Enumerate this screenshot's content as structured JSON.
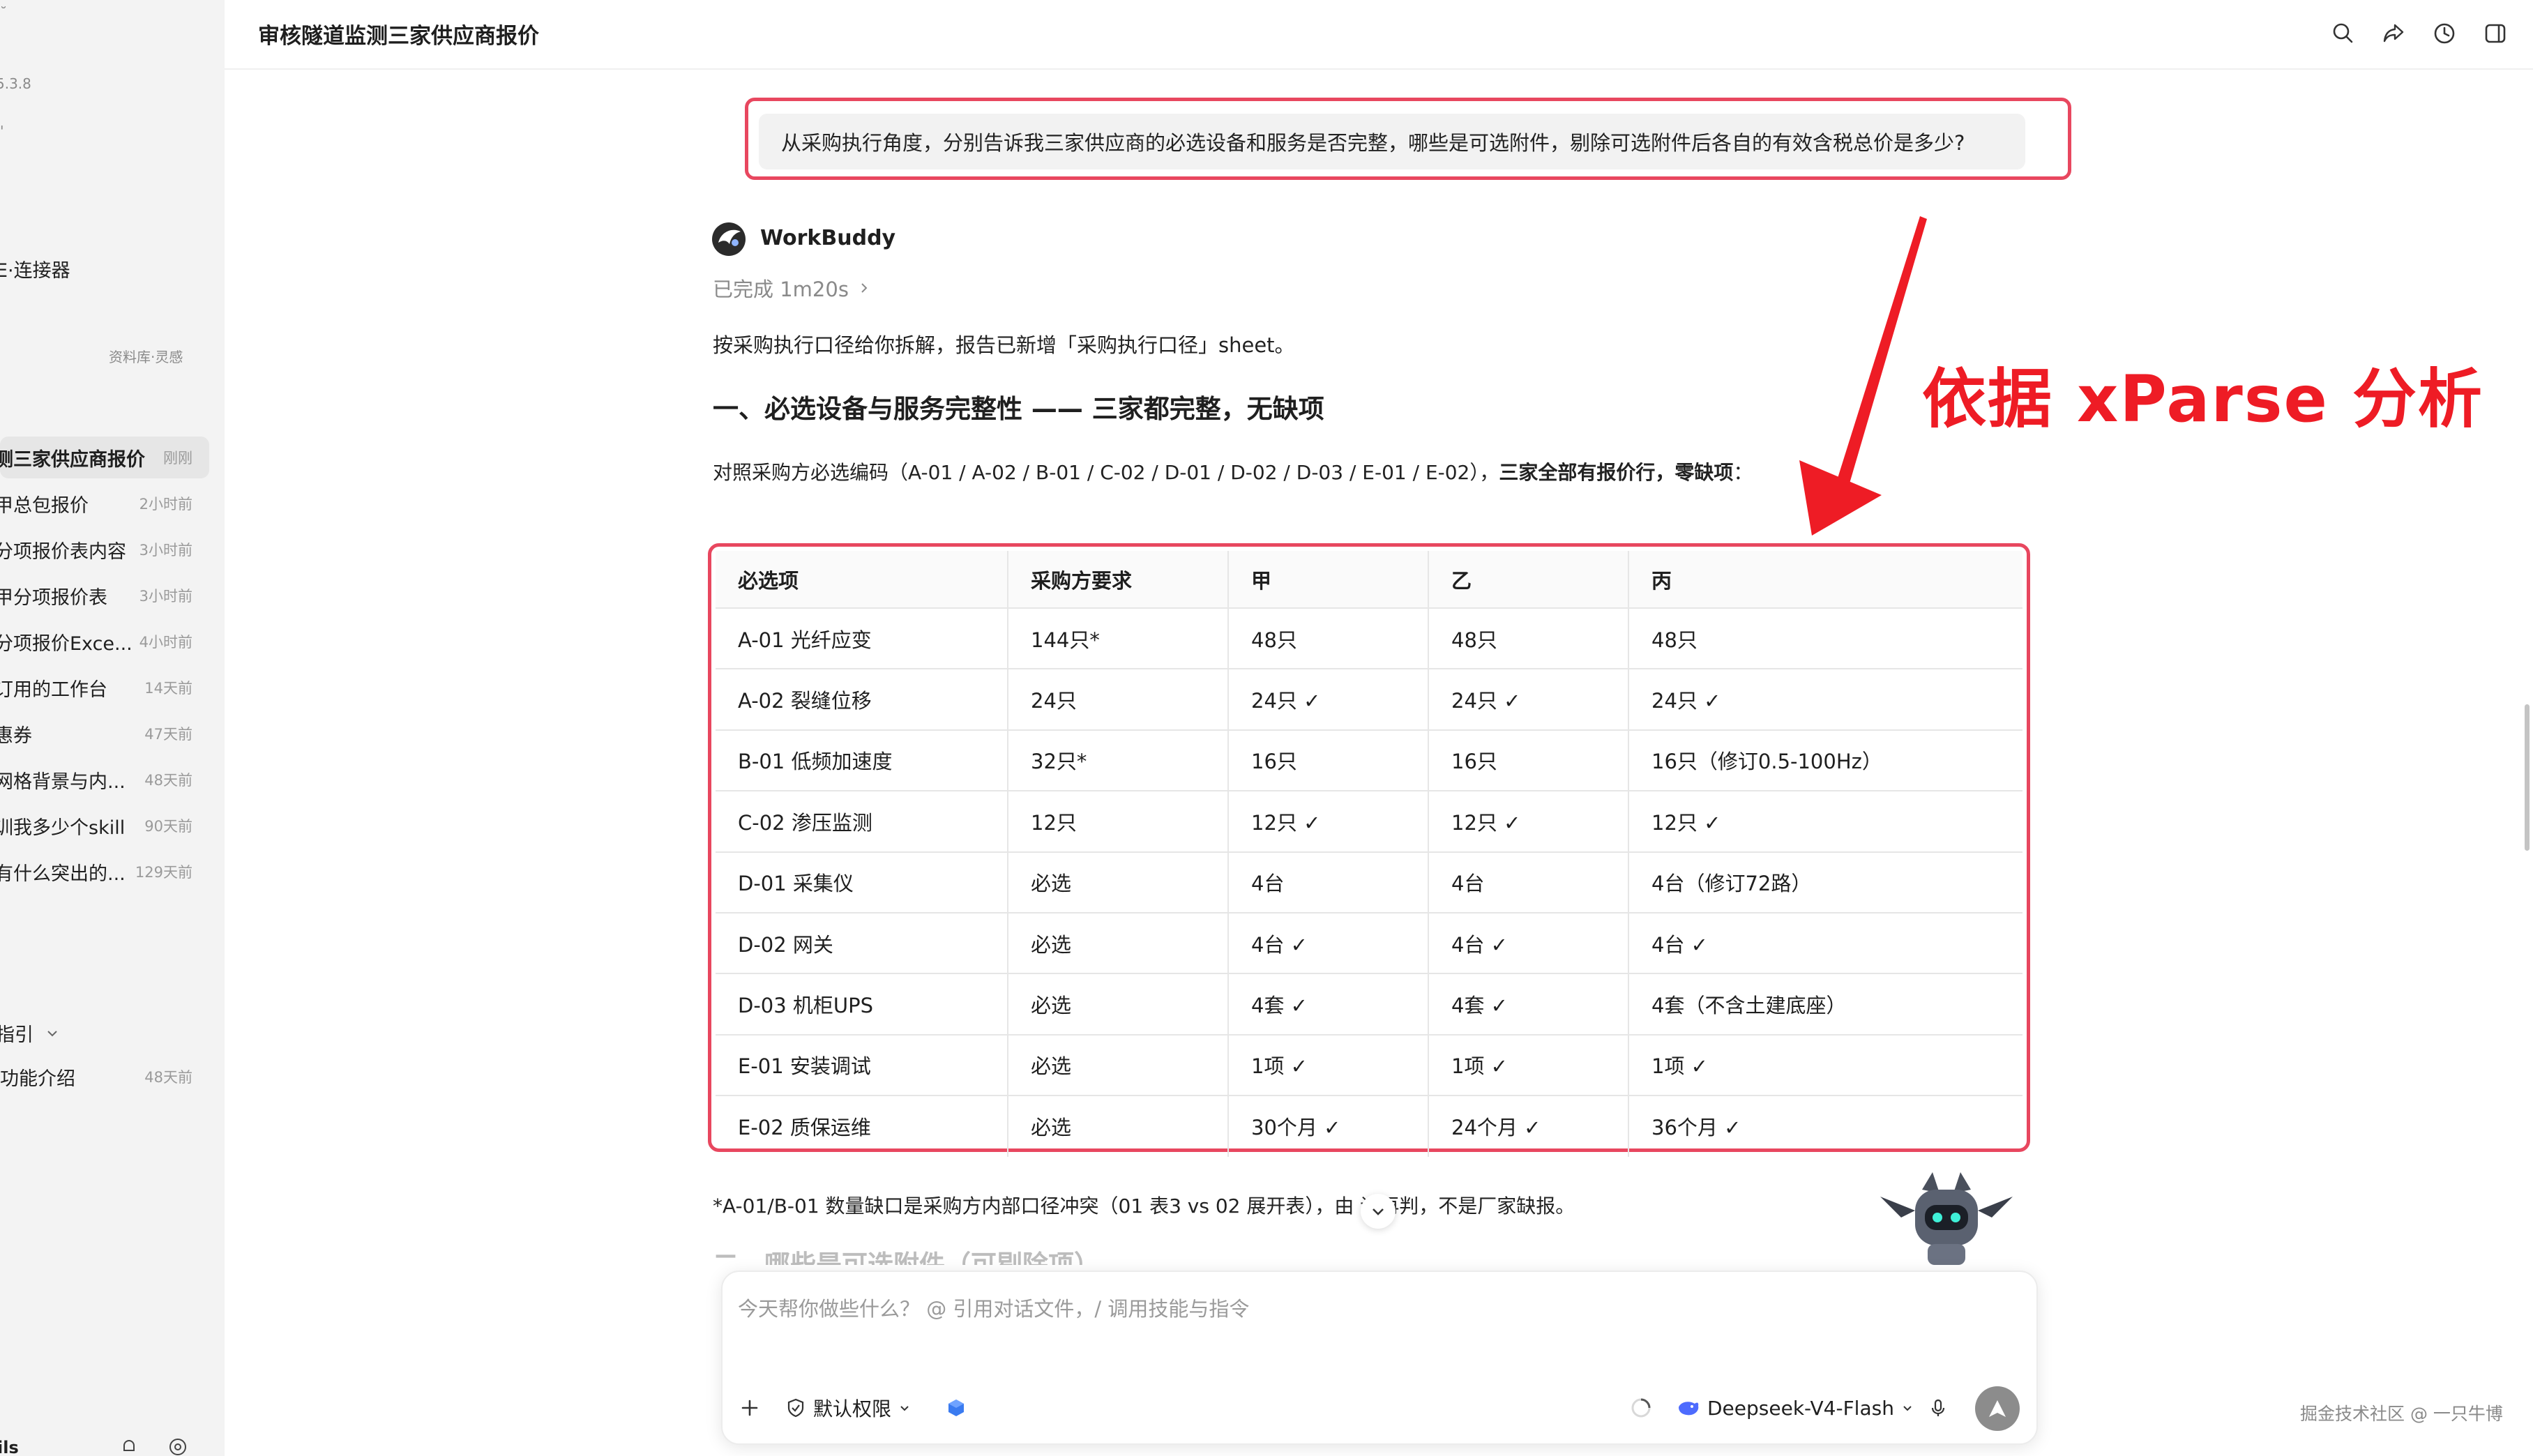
{
  "window": {
    "title": "审核隧道监测三家供应商报价"
  },
  "sidebar": {
    "version": "5.3.8",
    "connectors_label": "E·连接器",
    "library_label": "资料库·灵感",
    "history": [
      {
        "label": "测三家供应商报价",
        "time": "刚刚",
        "active": true
      },
      {
        "label": "甲总包报价",
        "time": "2小时前"
      },
      {
        "label": "分项报价表内容",
        "time": "3小时前"
      },
      {
        "label": "甲分项报价表",
        "time": "3小时前"
      },
      {
        "label": "分项报价Exce...",
        "time": "4小时前"
      },
      {
        "label": "订用的工作台",
        "time": "14天前"
      },
      {
        "label": "惠券",
        "time": "47天前"
      },
      {
        "label": "网格背景与内...",
        "time": "48天前"
      },
      {
        "label": "训我多少个skill",
        "time": "90天前"
      },
      {
        "label": "有什么突出的...",
        "time": "129天前"
      }
    ],
    "guide_label": "指引",
    "guide_item": {
      "label": "功能介绍",
      "time": "48天前"
    },
    "bottom_label": "ils"
  },
  "conversation": {
    "user_message": "从采购执行角度，分别告诉我三家供应商的必选设备和服务是否完整，哪些是可选附件，剔除可选附件后各自的有效含税总价是多少?",
    "bot": {
      "name": "WorkBuddy",
      "status": "已完成 1m20s",
      "intro": "按采购执行口径给你拆解，报告已新增「采购执行口径」sheet。",
      "heading1": "一、必选设备与服务完整性 —— 三家都完整，无缺项",
      "compare_prefix": "对照采购方必选编码（A-01 / A-02 / B-01 / C-02 / D-01 / D-02 / D-03 / E-01 / E-02），",
      "compare_bold": "三家全部有报价行，零缺项",
      "compare_suffix": "：",
      "table": {
        "headers": [
          "必选项",
          "采购方要求",
          "甲",
          "乙",
          "丙"
        ],
        "rows": [
          [
            "A-01 光纤应变",
            "144只*",
            "48只",
            "48只",
            "48只"
          ],
          [
            "A-02 裂缝位移",
            "24只",
            "24只 ✓",
            "24只 ✓",
            "24只 ✓"
          ],
          [
            "B-01 低频加速度",
            "32只*",
            "16只",
            "16只",
            "16只（修订0.5-100Hz）"
          ],
          [
            "C-02 渗压监测",
            "12只",
            "12只 ✓",
            "12只 ✓",
            "12只 ✓"
          ],
          [
            "D-01 采集仪",
            "必选",
            "4台",
            "4台",
            "4台（修订72路）"
          ],
          [
            "D-02 网关",
            "必选",
            "4台 ✓",
            "4台 ✓",
            "4台 ✓"
          ],
          [
            "D-03 机柜UPS",
            "必选",
            "4套 ✓",
            "4套 ✓",
            "4套（不含土建底座）"
          ],
          [
            "E-01 安装调试",
            "必选",
            "1项 ✓",
            "1项 ✓",
            "1项 ✓"
          ],
          [
            "E-02 质保运维",
            "必选",
            "30个月 ✓",
            "24个月 ✓",
            "36个月 ✓"
          ]
        ]
      },
      "footnote": "*A-01/B-01 数量缺口是采购方内部口径冲突（01 表3 vs 02 展开表），由 请再判，不是厂家缺报。",
      "heading2": "二、哪些是可选附件（可剔除项）"
    }
  },
  "annotation": {
    "text": "依据 xParse 分析",
    "color": "#ee1c25"
  },
  "input": {
    "placeholder": "今天帮你做些什么？ @ 引用对话文件，/ 调用技能与指令",
    "permission_label": "默认权限",
    "model_label": "Deepseek-V4-Flash"
  },
  "watermark": "掘金技术社区 @ 一只牛博",
  "colors": {
    "highlight_border": "#e8475f",
    "sidebar_bg": "#f3f3f3",
    "send_button": "#8c8c8c"
  }
}
